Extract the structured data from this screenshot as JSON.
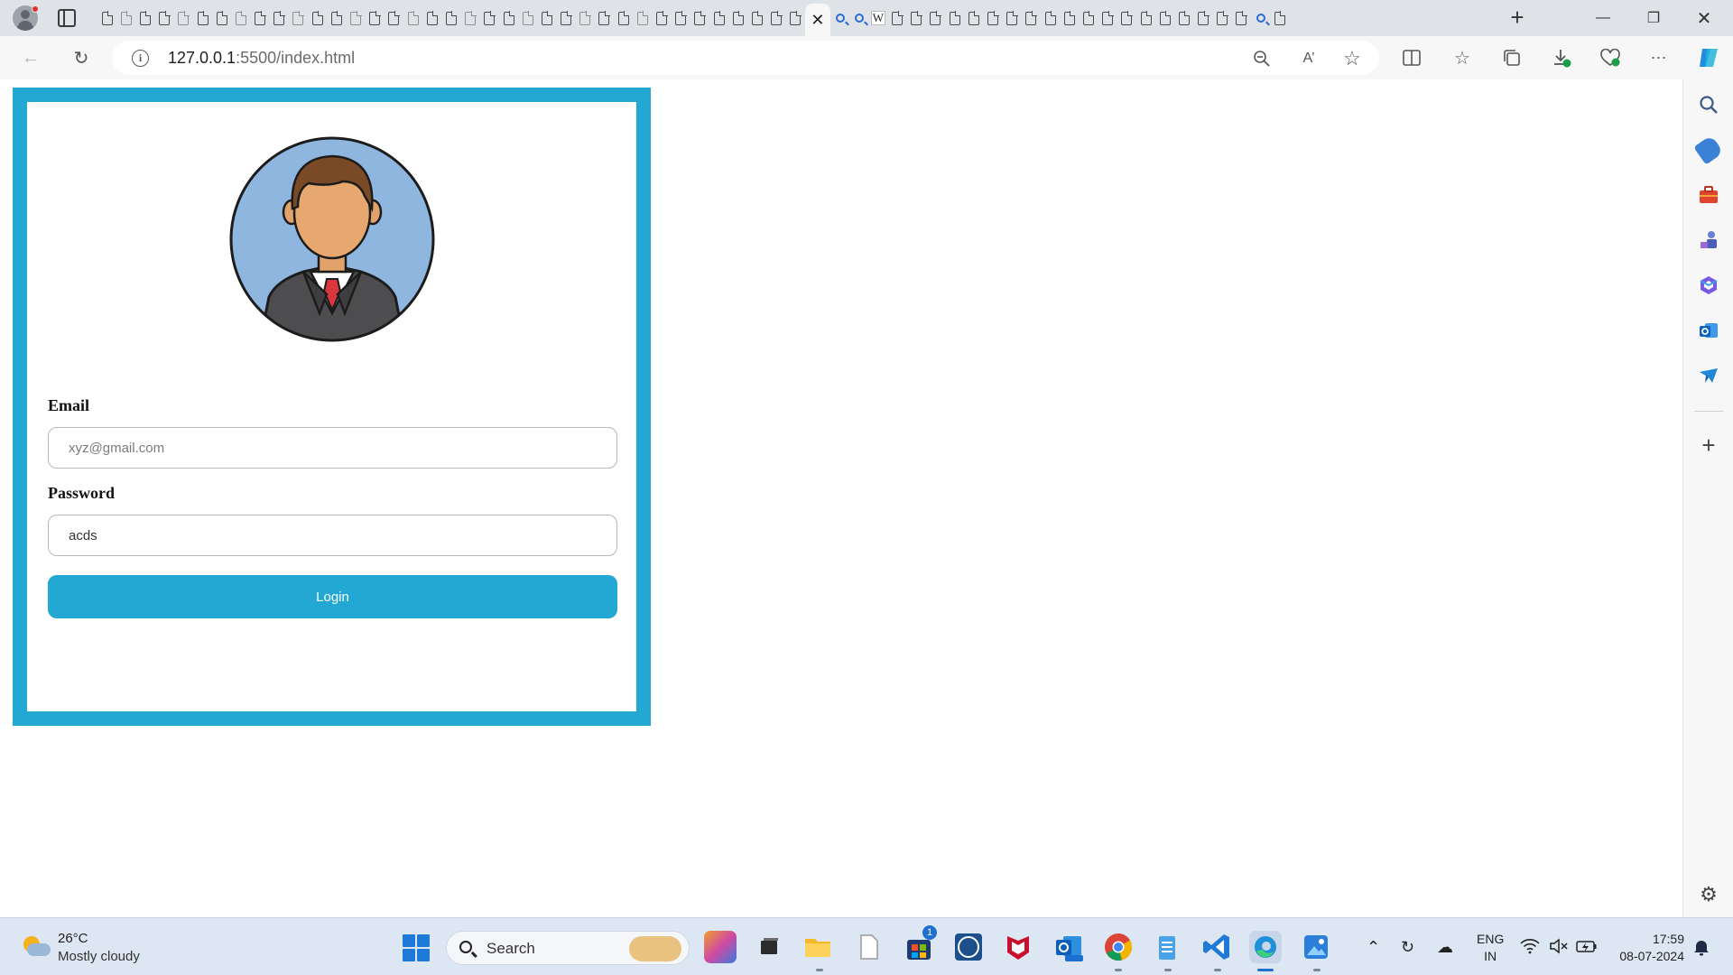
{
  "browser": {
    "url_host": "127.0.0.1",
    "url_rest": ":5500/index.html",
    "active_tab_close": "✕",
    "wiki_tab_letter": "W"
  },
  "login": {
    "email_label": "Email",
    "email_placeholder": "xyz@gmail.com",
    "password_label": "Password",
    "password_value": "acds",
    "login_button": "Login",
    "accent_color": "#23a7d3"
  },
  "taskbar": {
    "weather_temp": "26°C",
    "weather_desc": "Mostly cloudy",
    "search_label": "Search",
    "store_badge": "1",
    "lang_line1": "ENG",
    "lang_line2": "IN",
    "time": "17:59",
    "date": "08-07-2024"
  },
  "icons": {
    "tab_strip": [
      "profile-icon",
      "tab-actions-icon",
      "page-icon",
      "search-icon",
      "wikipedia-icon",
      "new-tab-icon"
    ],
    "window": [
      "minimize-icon",
      "restore-icon",
      "close-icon"
    ],
    "nav": [
      "back-icon",
      "refresh-icon",
      "site-info-icon",
      "zoom-out-icon",
      "read-aloud-icon",
      "favorite-star-icon",
      "split-screen-icon",
      "favorites-icon",
      "collections-icon",
      "downloads-icon",
      "browser-essentials-icon",
      "more-icon",
      "copilot-icon"
    ],
    "sidebar": [
      "search-icon",
      "shopping-icon",
      "tools-icon",
      "games-icon",
      "microsoft-365-icon",
      "outlook-icon",
      "drop-icon",
      "add-icon",
      "settings-icon"
    ]
  }
}
